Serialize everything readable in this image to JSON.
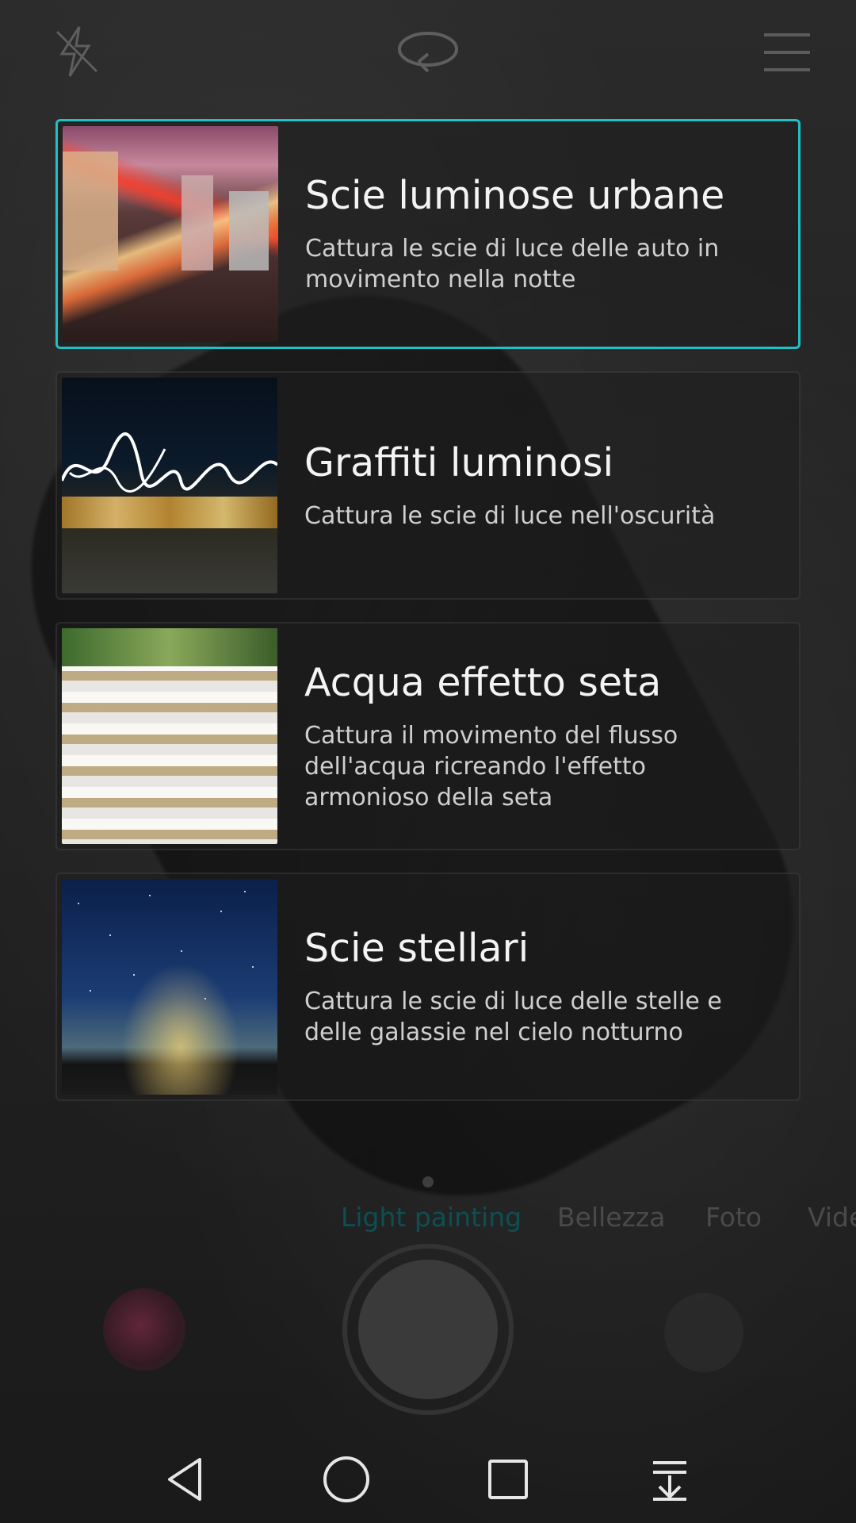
{
  "topbar": {
    "flash_icon": "flash-off-icon",
    "switch_camera_icon": "switch-camera-icon",
    "menu_icon": "menu-icon"
  },
  "cards": [
    {
      "title": "Scie luminose urbane",
      "description": "Cattura le scie di luce delle auto in\nmovimento nella notte",
      "selected": true
    },
    {
      "title": "Graffiti luminosi",
      "description": "Cattura le scie di luce nell'oscurità",
      "selected": false
    },
    {
      "title": "Acqua effetto seta",
      "description": "Cattura il movimento del flusso\ndell'acqua ricreando l'effetto\narmonioso della seta",
      "selected": false
    },
    {
      "title": "Scie stellari",
      "description": "Cattura le scie di luce delle stelle e\ndelle galassie nel cielo notturno",
      "selected": false
    }
  ],
  "modes": {
    "items": [
      "Light painting",
      "Bellezza",
      "Foto",
      "Vide"
    ],
    "active": "Light painting"
  },
  "colors": {
    "accent": "#1fc1c7",
    "active_mode": "#0d4f52"
  },
  "navbar": {
    "back_icon": "back-icon",
    "home_icon": "home-icon",
    "recent_icon": "recent-apps-icon",
    "notification_icon": "notification-pulldown-icon"
  }
}
